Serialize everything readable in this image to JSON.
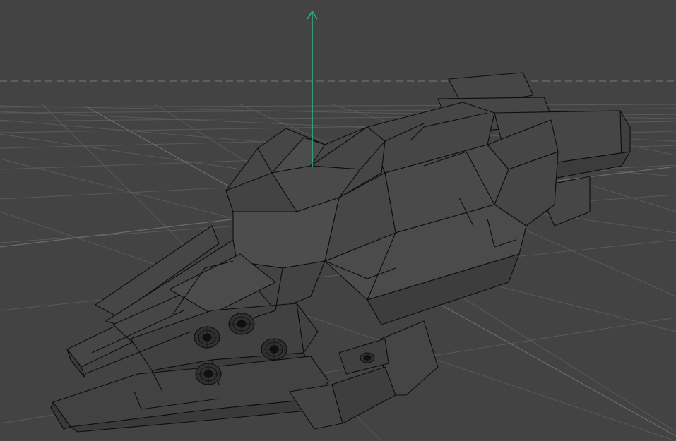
{
  "viewport": {
    "view": "perspective",
    "shading": "wireframe",
    "object": "spaceship-mesh",
    "gizmo_axis": "y",
    "grid": true,
    "horizon_line": "dashed"
  },
  "colors": {
    "background": "#434343",
    "grid": "#5a5a5a",
    "grid_major": "#6c6c6c",
    "mesh_face": "#454545",
    "mesh_face_light": "#4b4b4b",
    "mesh_edge": "#0d0d0d",
    "gizmo_y": "#2fb884",
    "horizon": "#7a7a7a"
  }
}
